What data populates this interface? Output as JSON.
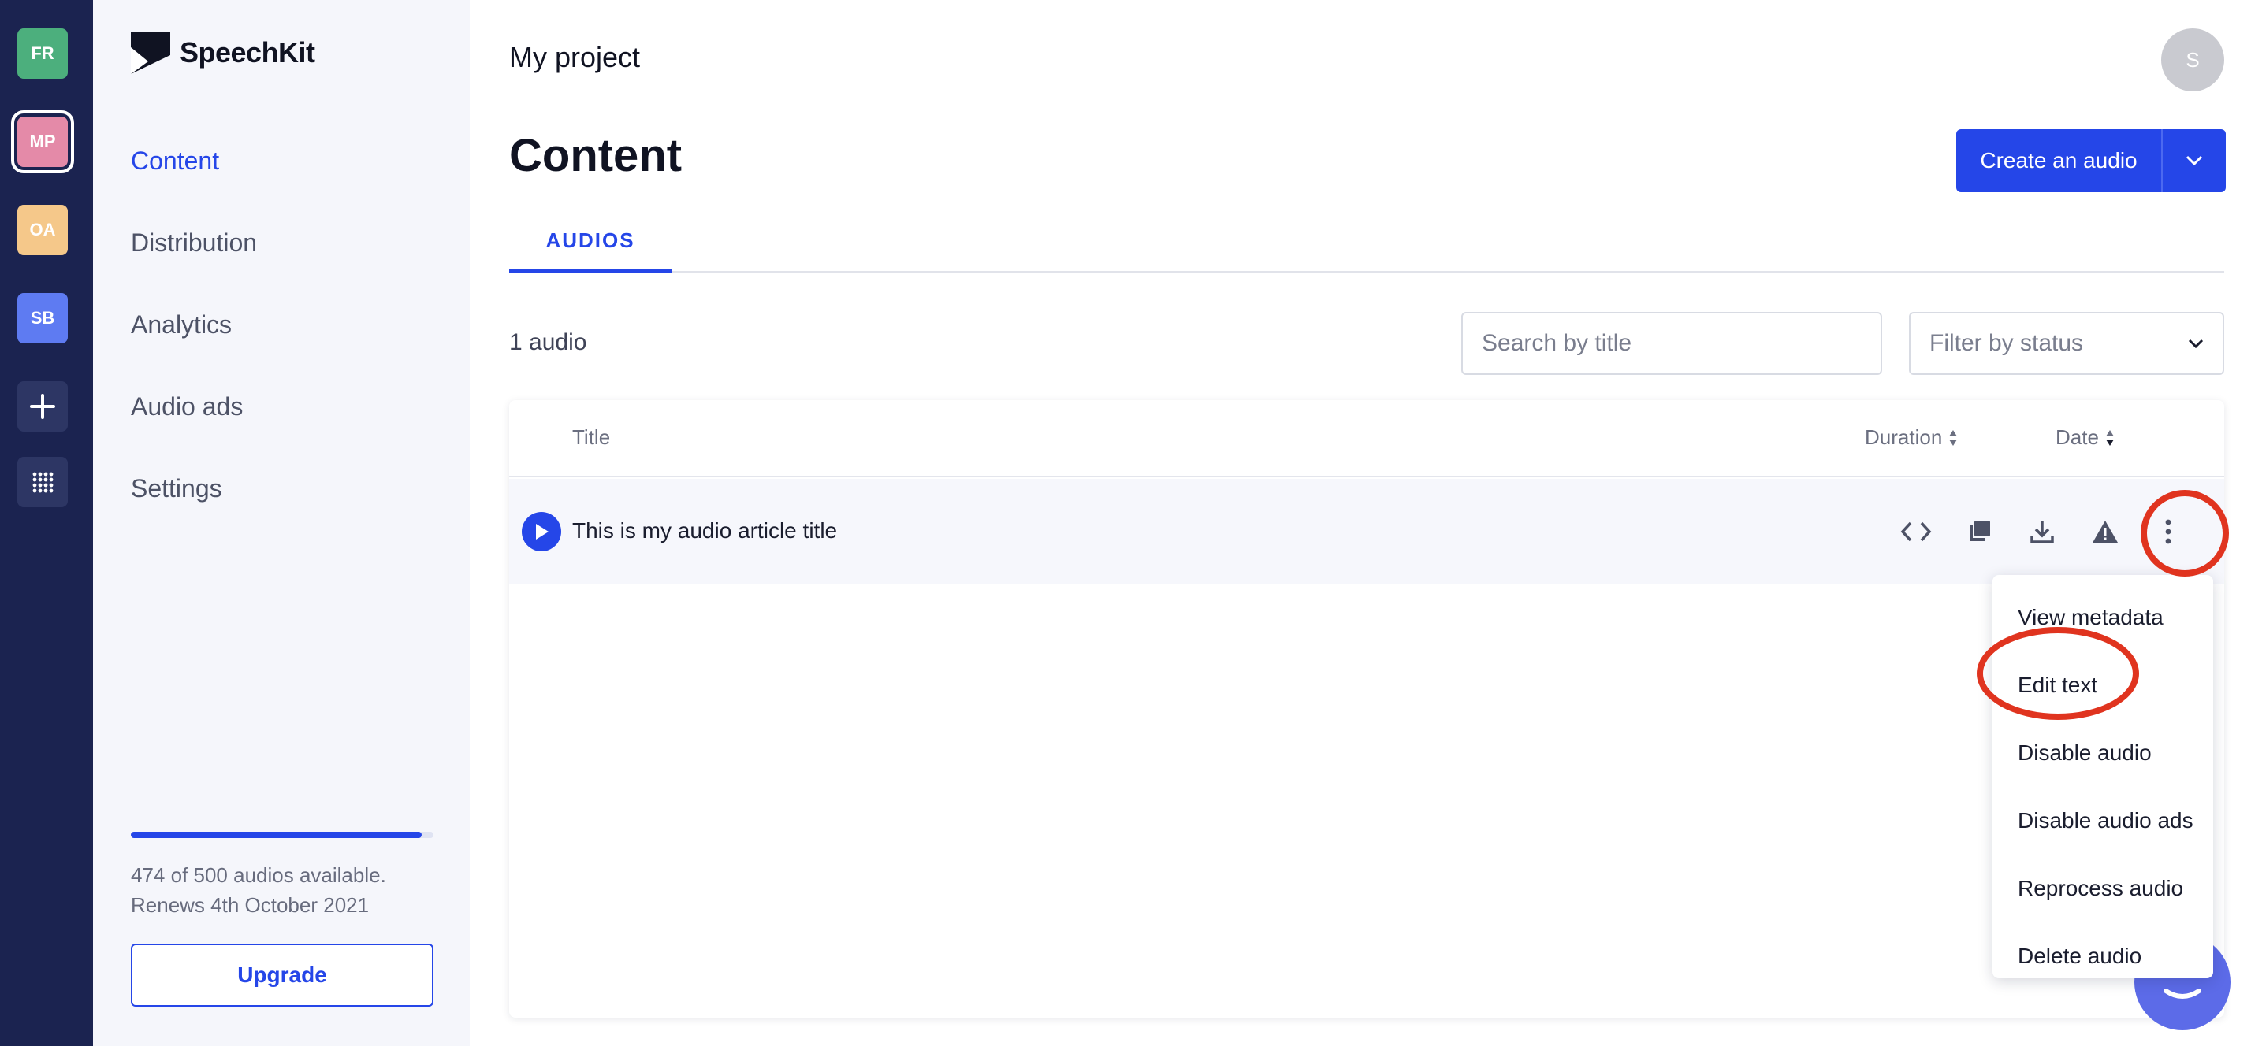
{
  "rail": {
    "projects": [
      {
        "initials": "FR",
        "color": "#4caf7d"
      },
      {
        "initials": "MP",
        "color": "#e48aa8",
        "active": true
      },
      {
        "initials": "OA",
        "color": "#f5c88a"
      },
      {
        "initials": "SB",
        "color": "#5e7bf2"
      }
    ],
    "add_icon": "plus-icon",
    "apps_icon": "grid-icon"
  },
  "sidebar": {
    "logo_text": "SpeechKit",
    "nav": [
      {
        "label": "Content",
        "active": true
      },
      {
        "label": "Distribution"
      },
      {
        "label": "Analytics"
      },
      {
        "label": "Audio ads"
      },
      {
        "label": "Settings"
      }
    ],
    "usage": {
      "used_fraction": 0.96,
      "line1": "474 of 500 audios available.",
      "line2": "Renews 4th October 2021"
    },
    "upgrade_label": "Upgrade"
  },
  "header": {
    "project_title": "My project",
    "avatar_initial": "S",
    "page_title": "Content",
    "create_label": "Create an audio"
  },
  "tabs": [
    {
      "label": "AUDIOS",
      "active": true
    }
  ],
  "toolbar": {
    "count_text": "1 audio",
    "search_placeholder": "Search by title",
    "filter_placeholder": "Filter by status"
  },
  "table": {
    "columns": {
      "title": "Title",
      "duration": "Duration",
      "date": "Date"
    },
    "rows": [
      {
        "title": "This is my audio article title"
      }
    ],
    "row_actions": [
      "embed-code-icon",
      "copy-icon",
      "download-icon",
      "warning-icon",
      "more-vertical-icon"
    ]
  },
  "menu": {
    "items": [
      "View metadata",
      "Edit text",
      "Disable audio",
      "Disable audio ads",
      "Reprocess audio",
      "Delete audio"
    ]
  },
  "colors": {
    "accent": "#2546e8",
    "rail_bg": "#1b2350",
    "highlight": "#e0341f"
  }
}
